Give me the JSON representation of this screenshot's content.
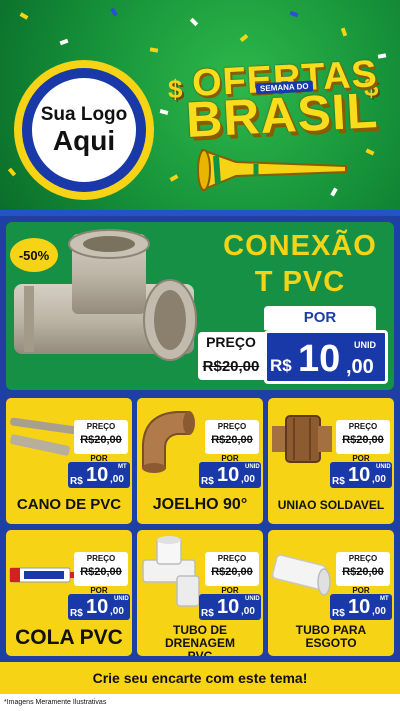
{
  "header": {
    "logo_line1": "Sua Logo",
    "logo_line2": "Aqui",
    "title_top": "OFERTAS",
    "title_sub": "SEMANA DO",
    "title_main": "BRASIL",
    "currency_symbol": "$"
  },
  "featured": {
    "discount": "-50%",
    "name_line1": "CONEXÃO",
    "name_line2": "T PVC",
    "por_label": "POR",
    "preco_label": "PREÇO",
    "old_price": "R$20,00",
    "currency": "R$",
    "price_int": "10",
    "price_cents": ",00",
    "unit": "UNID"
  },
  "products": [
    {
      "name": "CANO DE PVC",
      "preco_label": "PREÇO",
      "old_price": "R$20,00",
      "por_label": "POR",
      "currency": "R$",
      "price_int": "10",
      "price_cents": ",00",
      "unit": "MT"
    },
    {
      "name": "JOELHO 90°",
      "preco_label": "PREÇO",
      "old_price": "R$20,00",
      "por_label": "POR",
      "currency": "R$",
      "price_int": "10",
      "price_cents": ",00",
      "unit": "UNID"
    },
    {
      "name": "UNIAO SOLDAVEL",
      "preco_label": "PREÇO",
      "old_price": "R$20,00",
      "por_label": "POR",
      "currency": "R$",
      "price_int": "10",
      "price_cents": ",00",
      "unit": "UNID"
    },
    {
      "name": "COLA PVC",
      "preco_label": "PREÇO",
      "old_price": "R$20,00",
      "por_label": "POR",
      "currency": "R$",
      "price_int": "10",
      "price_cents": ",00",
      "unit": "UNID"
    },
    {
      "name": "TUBO DE DRENAGEM PVC",
      "preco_label": "PREÇO",
      "old_price": "R$20,00",
      "por_label": "POR",
      "currency": "R$",
      "price_int": "10",
      "price_cents": ",00",
      "unit": "UNID"
    },
    {
      "name": "TUBO PARA ESGOTO",
      "preco_label": "PREÇO",
      "old_price": "R$20,00",
      "por_label": "POR",
      "currency": "R$",
      "price_int": "10",
      "price_cents": ",00",
      "unit": "MT"
    }
  ],
  "cta": "Crie seu encarte com este tema!",
  "footer_note": "*Imagens Meramente Ilustrativas",
  "colors": {
    "green": "#159044",
    "yellow": "#f6d315",
    "blue": "#1a39a8",
    "white": "#ffffff"
  }
}
